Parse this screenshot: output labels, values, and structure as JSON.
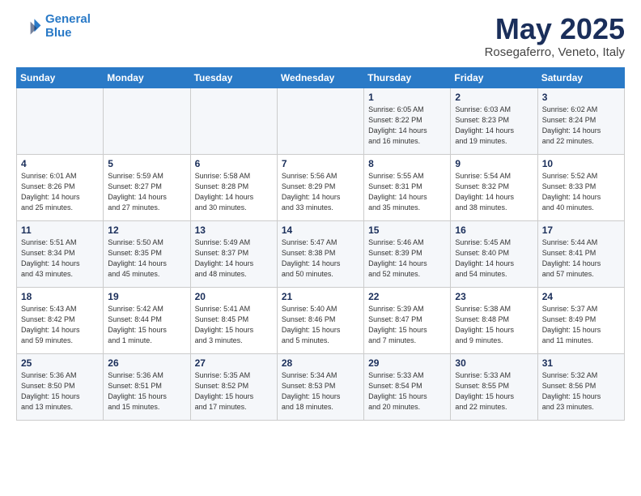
{
  "logo": {
    "line1": "General",
    "line2": "Blue"
  },
  "title": "May 2025",
  "location": "Rosegaferro, Veneto, Italy",
  "weekdays": [
    "Sunday",
    "Monday",
    "Tuesday",
    "Wednesday",
    "Thursday",
    "Friday",
    "Saturday"
  ],
  "weeks": [
    [
      {
        "day": "",
        "info": ""
      },
      {
        "day": "",
        "info": ""
      },
      {
        "day": "",
        "info": ""
      },
      {
        "day": "",
        "info": ""
      },
      {
        "day": "1",
        "info": "Sunrise: 6:05 AM\nSunset: 8:22 PM\nDaylight: 14 hours\nand 16 minutes."
      },
      {
        "day": "2",
        "info": "Sunrise: 6:03 AM\nSunset: 8:23 PM\nDaylight: 14 hours\nand 19 minutes."
      },
      {
        "day": "3",
        "info": "Sunrise: 6:02 AM\nSunset: 8:24 PM\nDaylight: 14 hours\nand 22 minutes."
      }
    ],
    [
      {
        "day": "4",
        "info": "Sunrise: 6:01 AM\nSunset: 8:26 PM\nDaylight: 14 hours\nand 25 minutes."
      },
      {
        "day": "5",
        "info": "Sunrise: 5:59 AM\nSunset: 8:27 PM\nDaylight: 14 hours\nand 27 minutes."
      },
      {
        "day": "6",
        "info": "Sunrise: 5:58 AM\nSunset: 8:28 PM\nDaylight: 14 hours\nand 30 minutes."
      },
      {
        "day": "7",
        "info": "Sunrise: 5:56 AM\nSunset: 8:29 PM\nDaylight: 14 hours\nand 33 minutes."
      },
      {
        "day": "8",
        "info": "Sunrise: 5:55 AM\nSunset: 8:31 PM\nDaylight: 14 hours\nand 35 minutes."
      },
      {
        "day": "9",
        "info": "Sunrise: 5:54 AM\nSunset: 8:32 PM\nDaylight: 14 hours\nand 38 minutes."
      },
      {
        "day": "10",
        "info": "Sunrise: 5:52 AM\nSunset: 8:33 PM\nDaylight: 14 hours\nand 40 minutes."
      }
    ],
    [
      {
        "day": "11",
        "info": "Sunrise: 5:51 AM\nSunset: 8:34 PM\nDaylight: 14 hours\nand 43 minutes."
      },
      {
        "day": "12",
        "info": "Sunrise: 5:50 AM\nSunset: 8:35 PM\nDaylight: 14 hours\nand 45 minutes."
      },
      {
        "day": "13",
        "info": "Sunrise: 5:49 AM\nSunset: 8:37 PM\nDaylight: 14 hours\nand 48 minutes."
      },
      {
        "day": "14",
        "info": "Sunrise: 5:47 AM\nSunset: 8:38 PM\nDaylight: 14 hours\nand 50 minutes."
      },
      {
        "day": "15",
        "info": "Sunrise: 5:46 AM\nSunset: 8:39 PM\nDaylight: 14 hours\nand 52 minutes."
      },
      {
        "day": "16",
        "info": "Sunrise: 5:45 AM\nSunset: 8:40 PM\nDaylight: 14 hours\nand 54 minutes."
      },
      {
        "day": "17",
        "info": "Sunrise: 5:44 AM\nSunset: 8:41 PM\nDaylight: 14 hours\nand 57 minutes."
      }
    ],
    [
      {
        "day": "18",
        "info": "Sunrise: 5:43 AM\nSunset: 8:42 PM\nDaylight: 14 hours\nand 59 minutes."
      },
      {
        "day": "19",
        "info": "Sunrise: 5:42 AM\nSunset: 8:44 PM\nDaylight: 15 hours\nand 1 minute."
      },
      {
        "day": "20",
        "info": "Sunrise: 5:41 AM\nSunset: 8:45 PM\nDaylight: 15 hours\nand 3 minutes."
      },
      {
        "day": "21",
        "info": "Sunrise: 5:40 AM\nSunset: 8:46 PM\nDaylight: 15 hours\nand 5 minutes."
      },
      {
        "day": "22",
        "info": "Sunrise: 5:39 AM\nSunset: 8:47 PM\nDaylight: 15 hours\nand 7 minutes."
      },
      {
        "day": "23",
        "info": "Sunrise: 5:38 AM\nSunset: 8:48 PM\nDaylight: 15 hours\nand 9 minutes."
      },
      {
        "day": "24",
        "info": "Sunrise: 5:37 AM\nSunset: 8:49 PM\nDaylight: 15 hours\nand 11 minutes."
      }
    ],
    [
      {
        "day": "25",
        "info": "Sunrise: 5:36 AM\nSunset: 8:50 PM\nDaylight: 15 hours\nand 13 minutes."
      },
      {
        "day": "26",
        "info": "Sunrise: 5:36 AM\nSunset: 8:51 PM\nDaylight: 15 hours\nand 15 minutes."
      },
      {
        "day": "27",
        "info": "Sunrise: 5:35 AM\nSunset: 8:52 PM\nDaylight: 15 hours\nand 17 minutes."
      },
      {
        "day": "28",
        "info": "Sunrise: 5:34 AM\nSunset: 8:53 PM\nDaylight: 15 hours\nand 18 minutes."
      },
      {
        "day": "29",
        "info": "Sunrise: 5:33 AM\nSunset: 8:54 PM\nDaylight: 15 hours\nand 20 minutes."
      },
      {
        "day": "30",
        "info": "Sunrise: 5:33 AM\nSunset: 8:55 PM\nDaylight: 15 hours\nand 22 minutes."
      },
      {
        "day": "31",
        "info": "Sunrise: 5:32 AM\nSunset: 8:56 PM\nDaylight: 15 hours\nand 23 minutes."
      }
    ]
  ]
}
